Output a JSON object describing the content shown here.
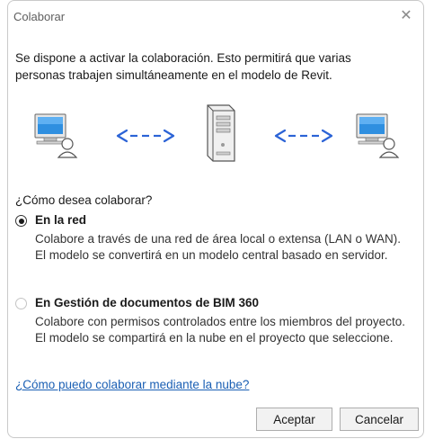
{
  "window": {
    "title": "Colaborar",
    "close_glyph": "✕"
  },
  "intro_text": "Se dispone a activar la colaboración. Esto permitirá que varias personas trabajen simultáneamente en el modelo de Revit.",
  "graphic": {
    "icons": [
      "workstation-icon",
      "double-arrow-icon",
      "server-icon",
      "double-arrow-icon",
      "workstation-icon"
    ],
    "accent": "#2b63d6"
  },
  "question": "¿Cómo desea colaborar?",
  "options": [
    {
      "label": "En la red",
      "description": "Colabore a través de una red de área local o extensa (LAN o WAN). El modelo se convertirá en un modelo central basado en servidor.",
      "selected": true,
      "enabled": true
    },
    {
      "label": "En Gestión de documentos de BIM 360",
      "description": "Colabore con permisos controlados entre los miembros del proyecto. El modelo se compartirá en la nube en el proyecto que seleccione.",
      "selected": false,
      "enabled": false
    }
  ],
  "help_link": "¿Cómo puedo colaborar mediante la nube?",
  "buttons": {
    "ok": "Aceptar",
    "cancel": "Cancelar"
  }
}
